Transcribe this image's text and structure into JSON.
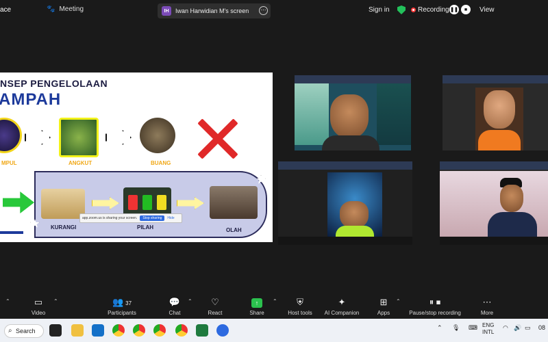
{
  "topbar": {
    "left_text": "ace",
    "meeting_label": "Meeting",
    "share_initials": "IH",
    "share_label": "Iwan Harwidian M's screen",
    "share_more": "⋯",
    "signin": "Sign in",
    "recording": "Recording...",
    "pause_glyph": "❚❚",
    "stop_glyph": "■",
    "view": "View"
  },
  "slide": {
    "title_line1": "NSEP PENGELOLAAN",
    "title_line2": "AMPAH",
    "labels": {
      "kumpul": "MPUL",
      "angkut": "ANGKUT",
      "buang": "BUANG",
      "kurangi": "KURANGI",
      "pilah": "PILAH",
      "olah": "OLAH"
    },
    "sharebar_text": "app.zoom.us is sharing your screen.",
    "sharebar_stop": "Stop sharing",
    "sharebar_hide": "Hide"
  },
  "toolbar": {
    "video": "Video",
    "participants": "Participants",
    "participants_count": "37",
    "chat": "Chat",
    "react": "React",
    "share": "Share",
    "host_tools": "Host tools",
    "ai_companion": "AI Companion",
    "apps": "Apps",
    "pause_stop": "Pause/stop recording",
    "more": "More"
  },
  "taskbar": {
    "search": "Search",
    "lang_top": "ENG",
    "lang_bottom": "INTL",
    "clock": "08"
  }
}
